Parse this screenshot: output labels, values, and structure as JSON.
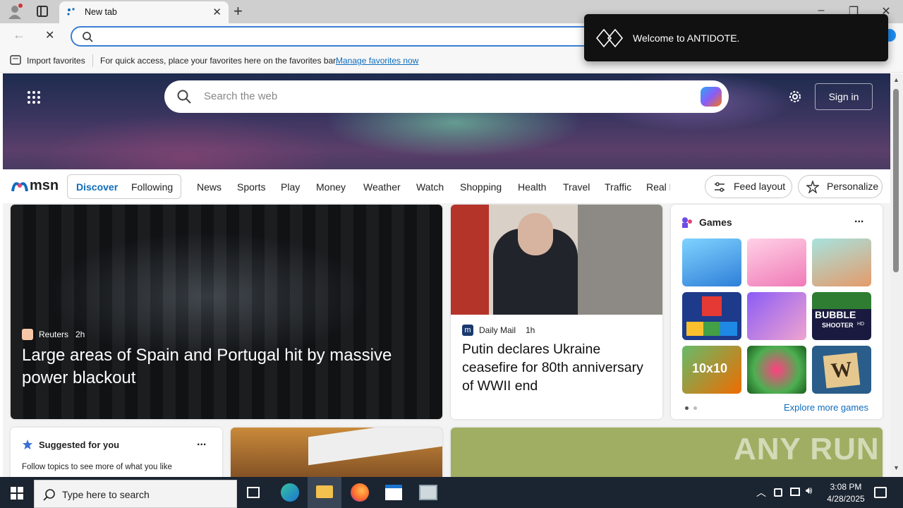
{
  "browser": {
    "tab_title": "New tab",
    "url_value": "",
    "favorites": {
      "import_label": "Import favorites",
      "hint_text": "For quick access, place your favorites here on the favorites bar.",
      "manage_link": "Manage favorites now"
    }
  },
  "toast": {
    "message": "Welcome to ANTIDOTE."
  },
  "msn": {
    "search_placeholder": "Search the web",
    "sign_in": "Sign in",
    "logo_text": "msn",
    "tabs": [
      "Discover",
      "Following"
    ],
    "nav": [
      "News",
      "Sports",
      "Play",
      "Money",
      "Weather",
      "Watch",
      "Shopping",
      "Health",
      "Travel",
      "Traffic",
      "Real E"
    ],
    "feed_layout": "Feed layout",
    "personalize": "Personalize"
  },
  "cards": {
    "main": {
      "source": "Reuters",
      "age": "2h",
      "headline": "Large areas of Spain and Portugal hit by massive power blackout"
    },
    "second": {
      "source": "Daily Mail",
      "age": "1h",
      "headline": "Putin declares Ukraine ceasefire for 80th anniversary of WWII end"
    },
    "games": {
      "title": "Games",
      "more_label": "...",
      "explore": "Explore more games",
      "tiles": [
        "customer-game",
        "dressup-game",
        "hospital-game",
        "block-puzzle-game",
        "makeup-game",
        "bubble-shooter-game",
        "10x10-game",
        "jewel-game",
        "word-game"
      ],
      "bubble_text": "BUBBLE",
      "shooter_text": "SHOOTER",
      "hd_text": "HD",
      "ten_text": "10x10",
      "w_text": "W"
    },
    "suggested": {
      "title": "Suggested for you",
      "more_label": "...",
      "body": "Follow topics to see more of what you like"
    }
  },
  "watermark": {
    "text": "ANY RUN"
  },
  "taskbar": {
    "search_placeholder": "Type here to search",
    "time": "3:08 PM",
    "date": "4/28/2025"
  },
  "colors": {
    "accent": "#0f6cbd",
    "addr_border": "#3b7fd4",
    "taskbar": "#1b2431",
    "toast_bg": "#111111"
  }
}
